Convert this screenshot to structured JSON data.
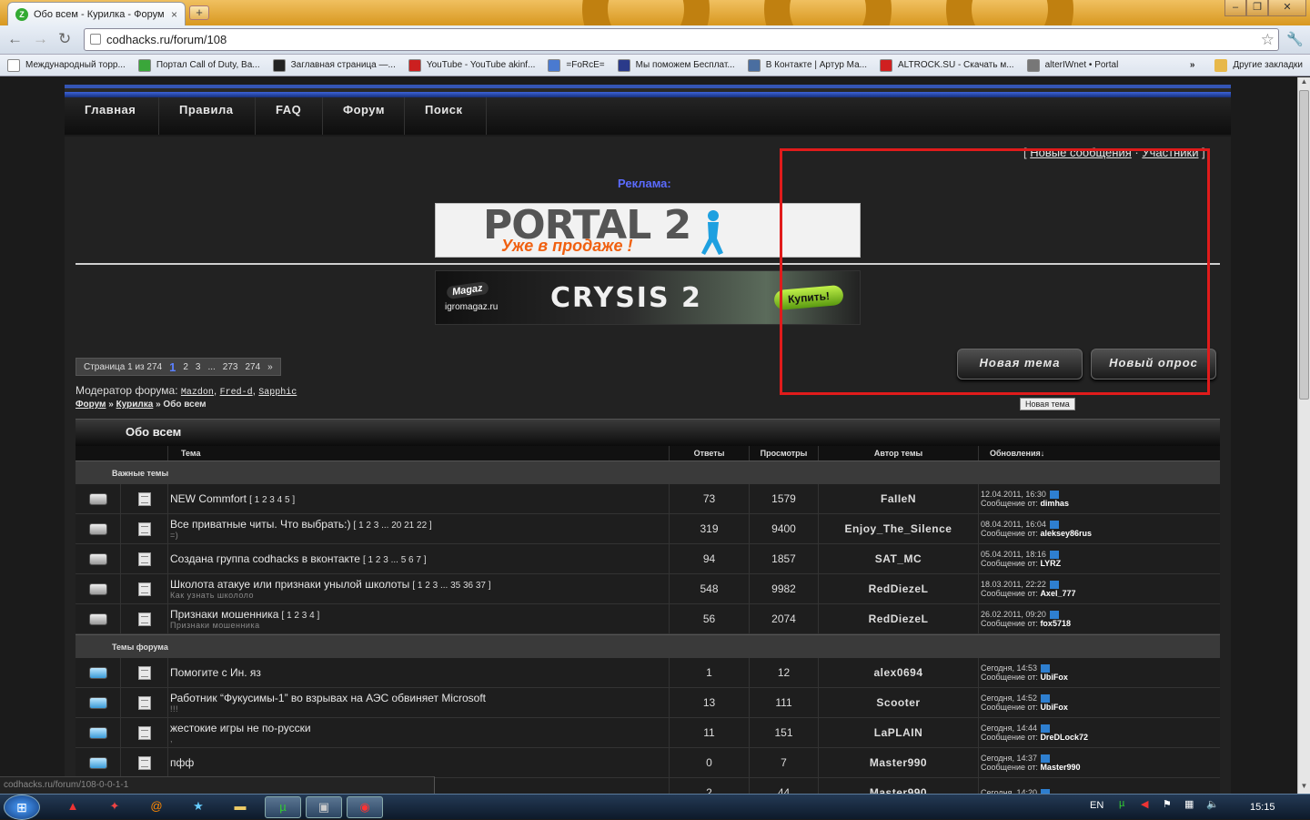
{
  "browser": {
    "tab_title": "Обо всем - Курилка - Форум",
    "tab_close": "×",
    "new_tab": "+",
    "url": "codhacks.ru/forum/108",
    "bookmarks": [
      {
        "label": "Международный торр...",
        "color": "#ffffff"
      },
      {
        "label": "Портал Call of Duty, Ba...",
        "color": "#3aa63a"
      },
      {
        "label": "Заглавная страница —...",
        "color": "#222222"
      },
      {
        "label": "YouTube - YouTube akinf...",
        "color": "#cc2020"
      },
      {
        "label": "=FoRcE=",
        "color": "#4a7ad0"
      },
      {
        "label": "Мы поможем Бесплат...",
        "color": "#2a3a8a"
      },
      {
        "label": "В Контакте | Артур Ма...",
        "color": "#4a6ea0"
      },
      {
        "label": "ALTROCK.SU - Скачать м...",
        "color": "#d02020"
      },
      {
        "label": "alterIWnet • Portal",
        "color": "#777777"
      }
    ],
    "other_bookmarks": "Другие закладки",
    "more": "»",
    "status_url": "codhacks.ru/forum/108-0-0-1-1"
  },
  "site_nav": [
    "Главная",
    "Правила",
    "FAQ",
    "Форум",
    "Поиск"
  ],
  "top_links": {
    "open": "[",
    "new_messages": "Новые сообщения",
    "sep": "·",
    "members": "Участники",
    "close": "]"
  },
  "ads": {
    "label": "Реклама:",
    "portal_title": "PORTAL 2",
    "portal_sub": "Уже в продаже !",
    "magaz_logo": "Magaz",
    "magaz_site": "igromagaz.ru",
    "crysis_title": "CRYSIS 2",
    "crysis_buy": "Купить!"
  },
  "pager": {
    "label": "Страница 1 из 274",
    "current": "1",
    "p2": "2",
    "p3": "3",
    "dots": "...",
    "p273": "273",
    "p274": "274",
    "next": "»"
  },
  "moderators": {
    "label": "Модератор форума:",
    "names": [
      "Mazdon",
      "Fred-d",
      "Sapphic"
    ]
  },
  "breadcrumb": {
    "forum": "Форум",
    "sep": "»",
    "section": "Курилка",
    "current": "Обо всем"
  },
  "buttons": {
    "new_topic": "Новая тема",
    "new_poll": "Новый опрос",
    "tooltip": "Новая тема"
  },
  "forum": {
    "title": "Обо всем",
    "columns": [
      "Тема",
      "Ответы",
      "Просмотры",
      "Автор темы",
      "Обновления↓"
    ],
    "section_pinned": "Важные темы",
    "section_topics": "Темы форума",
    "update_by_prefix": "Сообщение от:",
    "pinned": [
      {
        "title": "NEW Commfort",
        "pages": "[ 1 2 3 4 5 ]",
        "desc": "",
        "replies": "73",
        "views": "1579",
        "author": "FaIIeN",
        "date": "12.04.2011, 16:30",
        "by": "dimhas"
      },
      {
        "title": "Все приватные читы. Что выбрать:)",
        "pages": "[ 1 2 3 ... 20 21 22 ]",
        "desc": "=)",
        "replies": "319",
        "views": "9400",
        "author": "Enjoy_The_Silence",
        "date": "08.04.2011, 16:04",
        "by": "aleksey86rus"
      },
      {
        "title": "Создана группа codhacks в вконтакте",
        "pages": "[ 1 2 3 ... 5 6 7 ]",
        "desc": "",
        "replies": "94",
        "views": "1857",
        "author": "SAT_MC",
        "date": "05.04.2011, 18:16",
        "by": "LYRZ"
      },
      {
        "title": "Школота атакуе или признаки унылой школоты",
        "pages": "[ 1 2 3 ... 35 36 37 ]",
        "desc": "Как узнать школоло",
        "replies": "548",
        "views": "9982",
        "author": "RedDiezeL",
        "date": "18.03.2011, 22:22",
        "by": "Axel_777"
      },
      {
        "title": "Признаки мошенника",
        "pages": "[ 1 2 3 4 ]",
        "desc": "Признаки мошенника",
        "replies": "56",
        "views": "2074",
        "author": "RedDiezeL",
        "date": "26.02.2011, 09:20",
        "by": "fox5718"
      }
    ],
    "topics": [
      {
        "title": "Помогите с Ин. яз",
        "pages": "",
        "desc": "",
        "replies": "1",
        "views": "12",
        "author": "alex0694",
        "date": "Сегодня, 14:53",
        "by": "UbiFox"
      },
      {
        "title": "Работник “Фукусимы-1” во взрывах на АЭС обвиняет Microsoft",
        "pages": "",
        "desc": "!!!",
        "replies": "13",
        "views": "111",
        "author": "Scooter",
        "date": "Сегодня, 14:52",
        "by": "UbiFox"
      },
      {
        "title": "жестокие игры не по-русски",
        "pages": "",
        "desc": ",",
        "replies": "11",
        "views": "151",
        "author": "LaPLAIN",
        "date": "Сегодня, 14:44",
        "by": "DreDLock72"
      },
      {
        "title": "пфф",
        "pages": "",
        "desc": "",
        "replies": "0",
        "views": "7",
        "author": "Master990",
        "date": "Сегодня, 14:37",
        "by": "Master990"
      },
      {
        "title": "",
        "pages": "",
        "desc": "",
        "replies": "2",
        "views": "44",
        "author": "Master990",
        "date": "Сегодня, 14:20",
        "by": ""
      }
    ]
  },
  "taskbar": {
    "lang": "EN",
    "time": "15:15"
  },
  "colors": {
    "nav_accent": "#3455b5",
    "ad_label": "#5b6bff",
    "highlight_box": "#e01b1b"
  }
}
